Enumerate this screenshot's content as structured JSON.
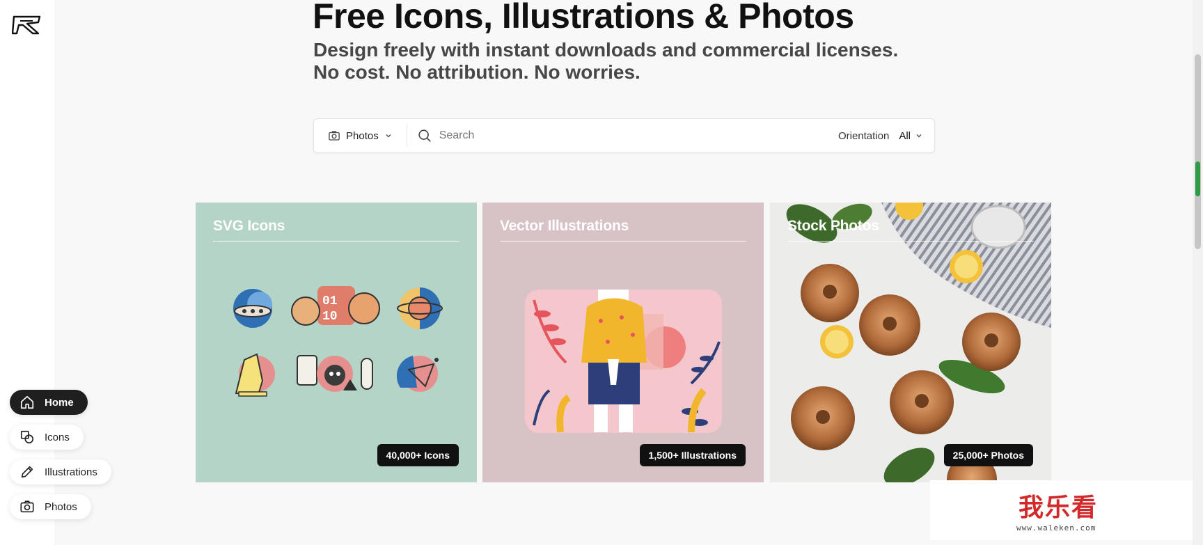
{
  "hero": {
    "title": "Free Icons, Illustrations & Photos",
    "subtitle_line1": "Design freely with instant downloads and commercial licenses.",
    "subtitle_line2": "No cost. No attribution. No worries."
  },
  "search": {
    "type_selected": "Photos",
    "placeholder": "Search",
    "orientation_label": "Orientation",
    "orientation_selected": "All"
  },
  "cards": [
    {
      "title": "SVG Icons",
      "badge": "40,000+ Icons",
      "bg": "#b3d4c6"
    },
    {
      "title": "Vector Illustrations",
      "badge": "1,500+ Illustrations",
      "bg": "#d7c2c6"
    },
    {
      "title": "Stock Photos",
      "badge": "25,000+ Photos",
      "bg": "#e6e6e4"
    }
  ],
  "nav": [
    {
      "label": "Home",
      "icon": "home-icon",
      "active": true
    },
    {
      "label": "Icons",
      "icon": "shapes-icon",
      "active": false
    },
    {
      "label": "Illustrations",
      "icon": "pencil-icon",
      "active": false
    },
    {
      "label": "Photos",
      "icon": "camera-icon",
      "active": false
    }
  ],
  "watermark": {
    "text": "我乐看",
    "url": "www.waleken.com"
  },
  "colors": {
    "accent": "#1f1f1f",
    "scroll_mark": "#2e9b47"
  }
}
